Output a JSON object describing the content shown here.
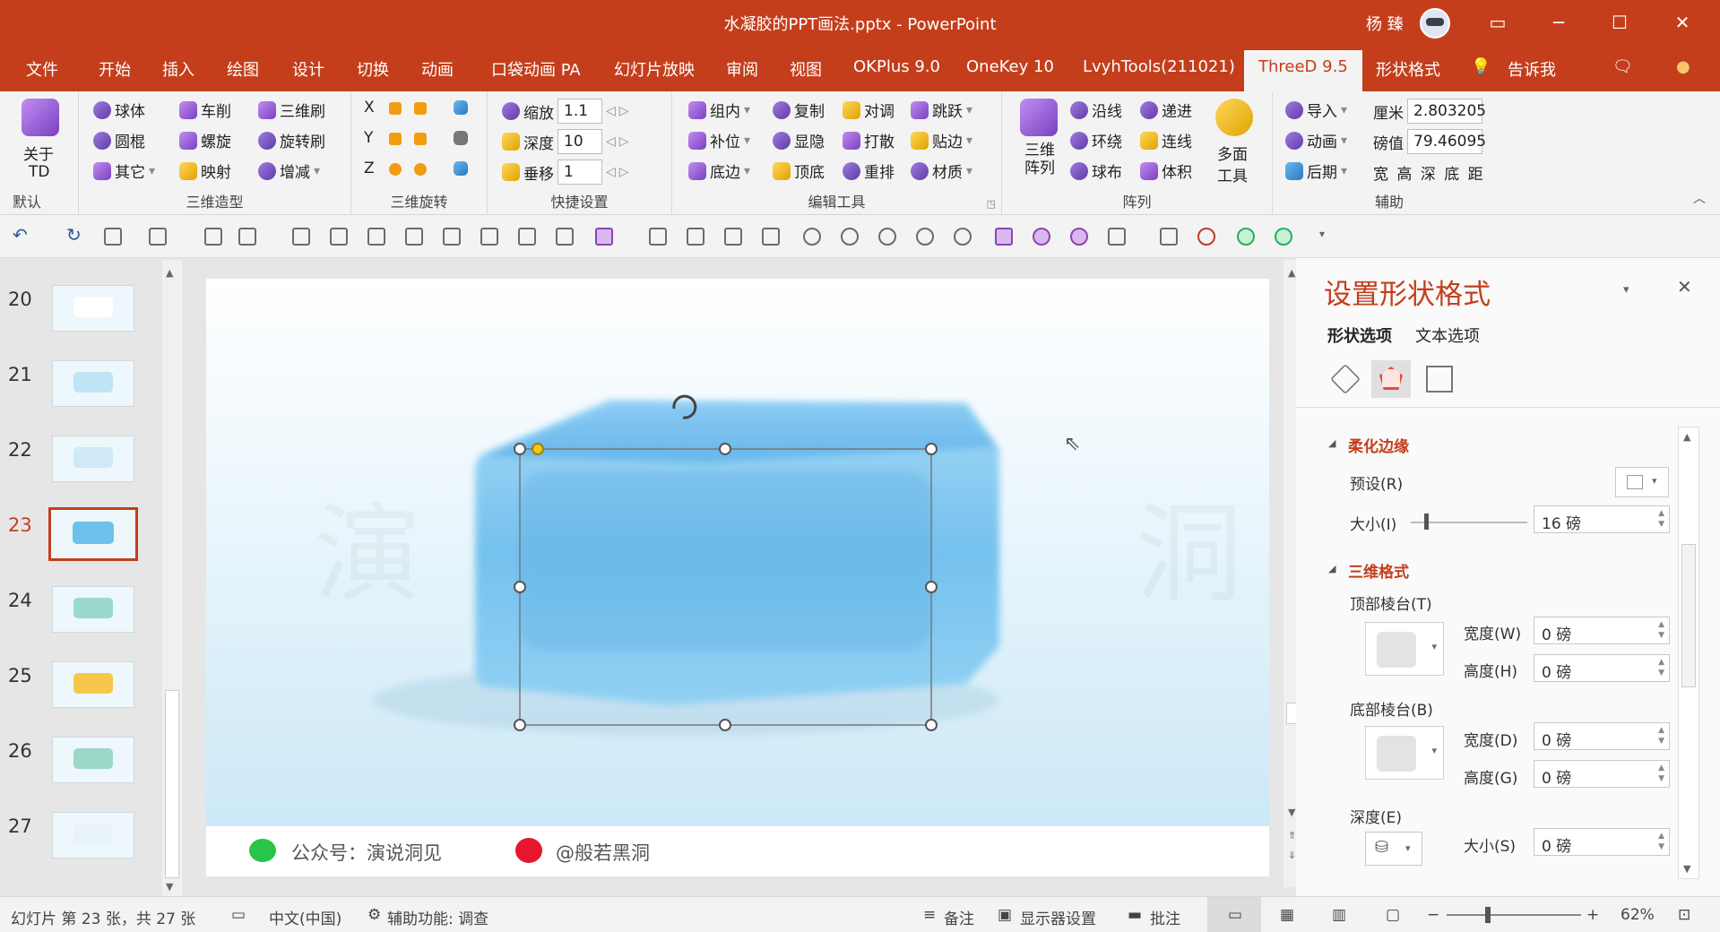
{
  "window": {
    "title": "水凝胶的PPT画法.pptx - PowerPoint",
    "user": "杨 臻",
    "controls": [
      "▭",
      "─",
      "☐",
      "✕"
    ]
  },
  "tabs": [
    "文件",
    "开始",
    "插入",
    "绘图",
    "设计",
    "切换",
    "动画",
    "口袋动画 PA",
    "幻灯片放映",
    "审阅",
    "视图",
    "OKPlus 9.0",
    "OneKey 10",
    "LvyhTools(211021)",
    "ThreeD 9.5",
    "形状格式"
  ],
  "active_tab": "ThreeD 9.5",
  "tell_me": "告诉我",
  "ribbon": {
    "about": {
      "line1": "关于",
      "line2": "TD",
      "group": "默认"
    },
    "modeling": {
      "group": "三维造型",
      "items": [
        "球体",
        "车削",
        "三维刷",
        "圆棍",
        "螺旋",
        "旋转刷",
        "其它",
        "映射",
        "增减"
      ]
    },
    "rotation": {
      "group": "三维旋转",
      "axes": [
        "X",
        "Y",
        "Z"
      ]
    },
    "quick": {
      "group": "快捷设置",
      "labels": [
        "缩放",
        "深度",
        "垂移"
      ],
      "values": [
        "1.1",
        "10",
        "1"
      ]
    },
    "edit": {
      "group": "编辑工具",
      "items": [
        "组内",
        "复制",
        "对调",
        "跳跃",
        "补位",
        "显隐",
        "打散",
        "贴边",
        "底边",
        "顶底",
        "重排",
        "材质"
      ]
    },
    "array": {
      "group": "阵列",
      "big": "三维阵列",
      "items": [
        "沿线",
        "递进",
        "环绕",
        "连线",
        "球布",
        "体积"
      ],
      "multi_line1": "多面",
      "multi_line2": "工具"
    },
    "aux": {
      "group": "辅助",
      "items": [
        "导入",
        "动画",
        "后期"
      ],
      "units": [
        "厘米",
        "磅值"
      ],
      "values": [
        "2.803205",
        "79.46095"
      ],
      "dims": "宽 高 深 底 距"
    }
  },
  "thumbnails": [
    {
      "num": "20",
      "color": "#ffffff"
    },
    {
      "num": "21",
      "color": "#bfe4f5"
    },
    {
      "num": "22",
      "color": "#cfeaf6"
    },
    {
      "num": "23",
      "color": "#6cc2ea"
    },
    {
      "num": "24",
      "color": "#9ad8d0"
    },
    {
      "num": "25",
      "color": "#f5c84a"
    },
    {
      "num": "26",
      "color": "#9ad8c8"
    },
    {
      "num": "27",
      "color": "#e8f4f8"
    }
  ],
  "selected_slide": "23",
  "slide": {
    "footer_wechat": "公众号：演说洞见",
    "footer_weibo": "@般若黑洞",
    "watermark": "演 说 洞 见"
  },
  "pane": {
    "title": "设置形状格式",
    "tab_shape": "形状选项",
    "tab_text": "文本选项",
    "soft_edges": {
      "header": "柔化边缘",
      "preset_label": "预设(R)",
      "size_label": "大小(I)",
      "size_value": "16 磅"
    },
    "format3d": {
      "header": "三维格式",
      "top_bevel": "顶部棱台(T)",
      "bottom_bevel": "底部棱台(B)",
      "width_top_label": "宽度(W)",
      "height_top_label": "高度(H)",
      "width_bottom_label": "宽度(D)",
      "height_bottom_label": "高度(G)",
      "zero": "0 磅",
      "depth_label": "深度(E)",
      "size_label": "大小(S)"
    }
  },
  "status": {
    "slide_info": "幻灯片 第 23 张，共 27 张",
    "language": "中文(中国)",
    "accessibility": "辅助功能: 调查",
    "notes": "备注",
    "display": "显示器设置",
    "comments": "批注",
    "zoom": "62%"
  }
}
